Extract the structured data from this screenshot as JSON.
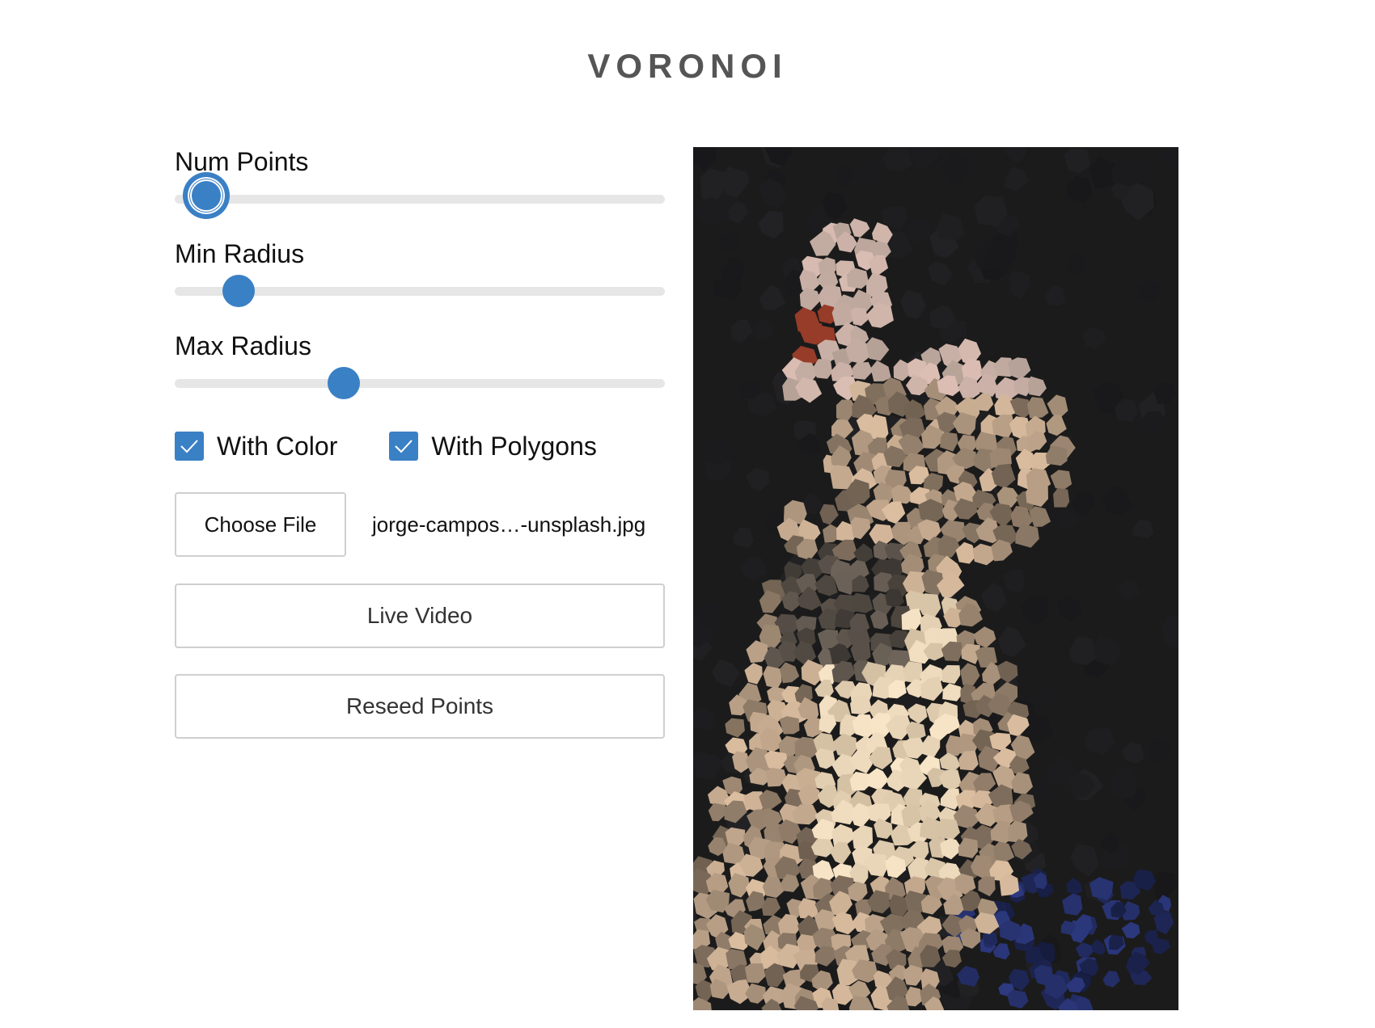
{
  "title": "VORONOI",
  "controls": {
    "num_points": {
      "label": "Num Points",
      "value": 0.065
    },
    "min_radius": {
      "label": "Min Radius",
      "value": 0.13
    },
    "max_radius": {
      "label": "Max Radius",
      "value": 0.345
    },
    "with_color": {
      "label": "With Color",
      "checked": true
    },
    "with_polygons": {
      "label": "With Polygons",
      "checked": true
    },
    "file": {
      "button_label": "Choose File",
      "file_name": "jorge-campos…-unsplash.jpg"
    },
    "live_video_label": "Live Video",
    "reseed_label": "Reseed Points"
  },
  "colors": {
    "accent": "#3a80c5",
    "canvas_background": "#1b1b1b",
    "title": "#555555"
  },
  "canvas": {
    "description_icon": "voronoi-mosaic-image"
  }
}
